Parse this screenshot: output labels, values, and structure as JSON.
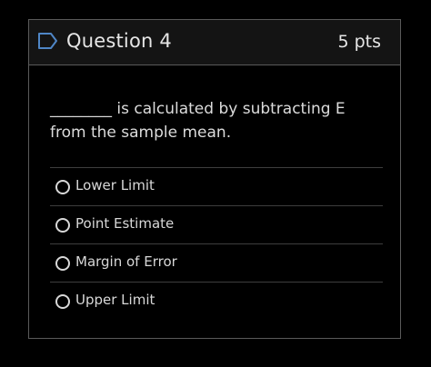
{
  "question": {
    "title": "Question 4",
    "points": "5 pts",
    "prompt": "________ is calculated by subtracting E from the sample mean.",
    "flag_icon": "flag-icon",
    "colors": {
      "background": "#000000",
      "header_bg": "#141414",
      "border": "#5a5a5a",
      "text": "#e6e6e6"
    }
  },
  "answers": [
    {
      "label": "Lower Limit",
      "selected": false
    },
    {
      "label": "Point Estimate",
      "selected": false
    },
    {
      "label": "Margin of Error",
      "selected": false
    },
    {
      "label": "Upper Limit",
      "selected": false
    }
  ]
}
